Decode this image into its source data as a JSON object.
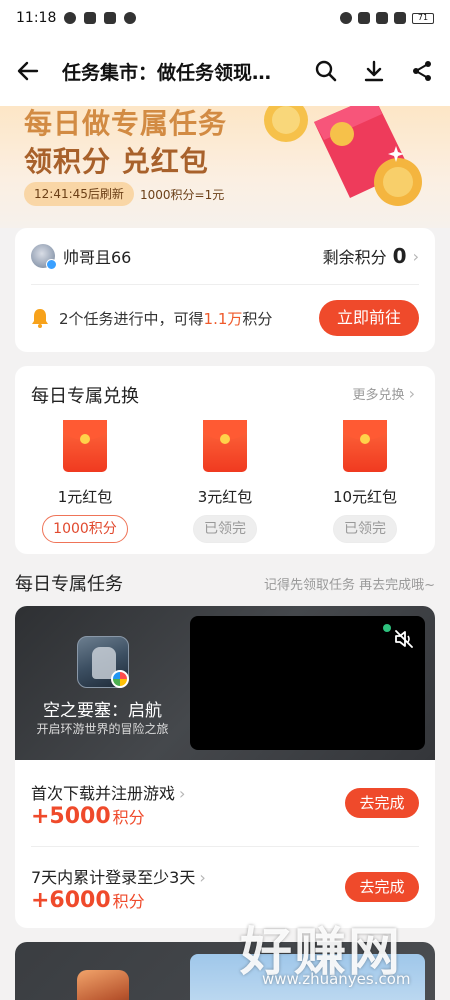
{
  "status_bar": {
    "time": "11:18",
    "battery": "71"
  },
  "nav": {
    "title": "任务集市：做任务领现…",
    "icons": [
      "back-arrow-icon",
      "search-icon",
      "download-icon",
      "share-icon"
    ]
  },
  "banner": {
    "line1": "每日做专属任务",
    "line2": "领积分 兑红包",
    "refresh": "12:41:45后刷新",
    "rate": "1000积分=1元"
  },
  "user": {
    "name": "帅哥且66",
    "points_label": "剩余积分",
    "points_value": "0",
    "tasks_pre": "2个任务进行中，可得",
    "tasks_highlight": "1.1万",
    "tasks_post": "积分",
    "go_label": "立即前往"
  },
  "exchange": {
    "title": "每日专属兑换",
    "more": "更多兑换",
    "items": [
      {
        "name": "1元红包",
        "button": "1000积分",
        "state": "active"
      },
      {
        "name": "3元红包",
        "button": "已领完",
        "state": "done"
      },
      {
        "name": "10元红包",
        "button": "已领完",
        "state": "done"
      }
    ]
  },
  "daily": {
    "title": "每日专属任务",
    "hint": "记得先领取任务 再去完成哦~"
  },
  "game": {
    "name": "空之要塞：启航",
    "desc": "开启环游世界的冒险之旅",
    "tasks": [
      {
        "title": "首次下载并注册游戏",
        "points": "+5000",
        "unit": "积分",
        "button": "去完成"
      },
      {
        "title": "7天内累计登录至少3天",
        "points": "+6000",
        "unit": "积分",
        "button": "去完成"
      }
    ]
  },
  "watermark": {
    "text": "好赚网",
    "url": "www.zhuanyes.com"
  },
  "colors": {
    "accent": "#ef4a2b",
    "banner_text": "#a8612b"
  }
}
